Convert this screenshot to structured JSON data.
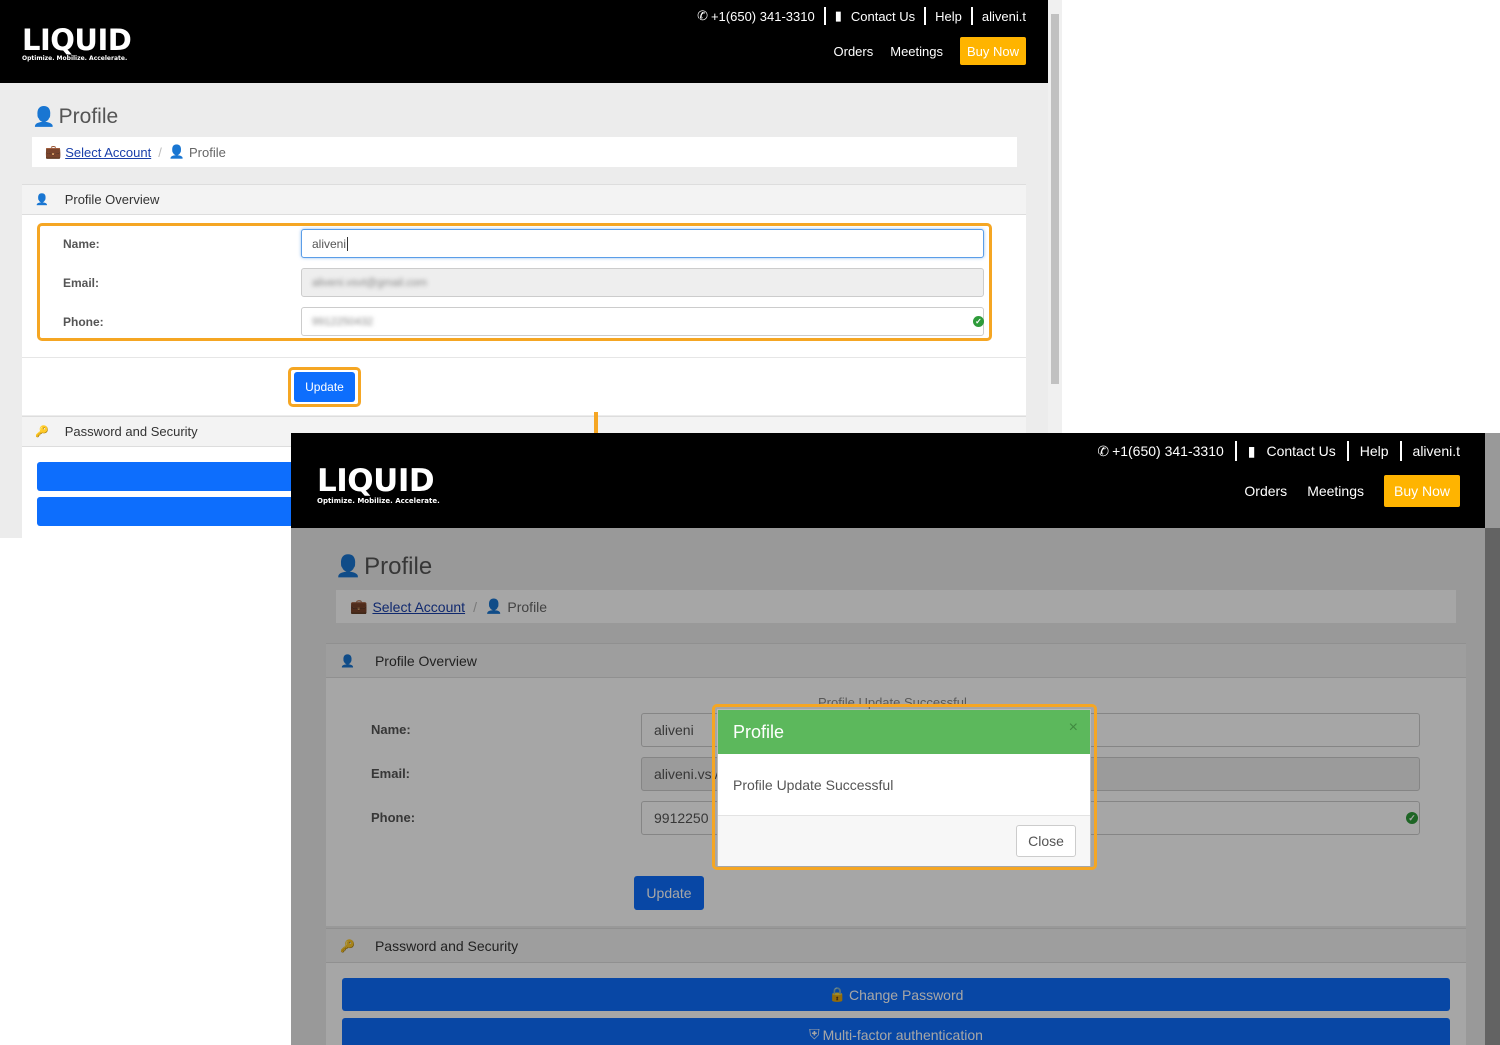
{
  "header": {
    "logo_text": "LIQUID",
    "logo_tagline": "Optimize. Mobilize. Accelerate.",
    "phone": "+1(650) 341-3310",
    "contact": "Contact Us",
    "help": "Help",
    "user": "aliveni.t",
    "orders": "Orders",
    "meetings": "Meetings",
    "buy_now": "Buy Now"
  },
  "page": {
    "title": "Profile",
    "breadcrumb_account": "Select Account",
    "breadcrumb_current": "Profile"
  },
  "profile_overview": {
    "heading": "Profile Overview",
    "name_label": "Name:",
    "email_label": "Email:",
    "phone_label": "Phone:",
    "name_value": "aliveni",
    "email_value_blurred": "aliveni.vsvt@gmail.com",
    "phone_value_blurred": "9912250432",
    "email_value_partial": "aliveni.vsv",
    "phone_value_partial": "9912250",
    "hidden_message": "Profile Update Successful",
    "update_button": "Update"
  },
  "security": {
    "heading": "Password and Security",
    "change_password": "Change Password",
    "mfa": "Multi-factor authentication"
  },
  "modal": {
    "title": "Profile",
    "message": "Profile Update Successful",
    "close_button": "Close",
    "close_icon": "×"
  },
  "colors": {
    "accent_orange": "#f5a623",
    "buy_now_bg": "#ffb400",
    "primary_blue": "#0d6efd",
    "modal_header_green": "#5cb85c",
    "header_bg": "#000000"
  }
}
